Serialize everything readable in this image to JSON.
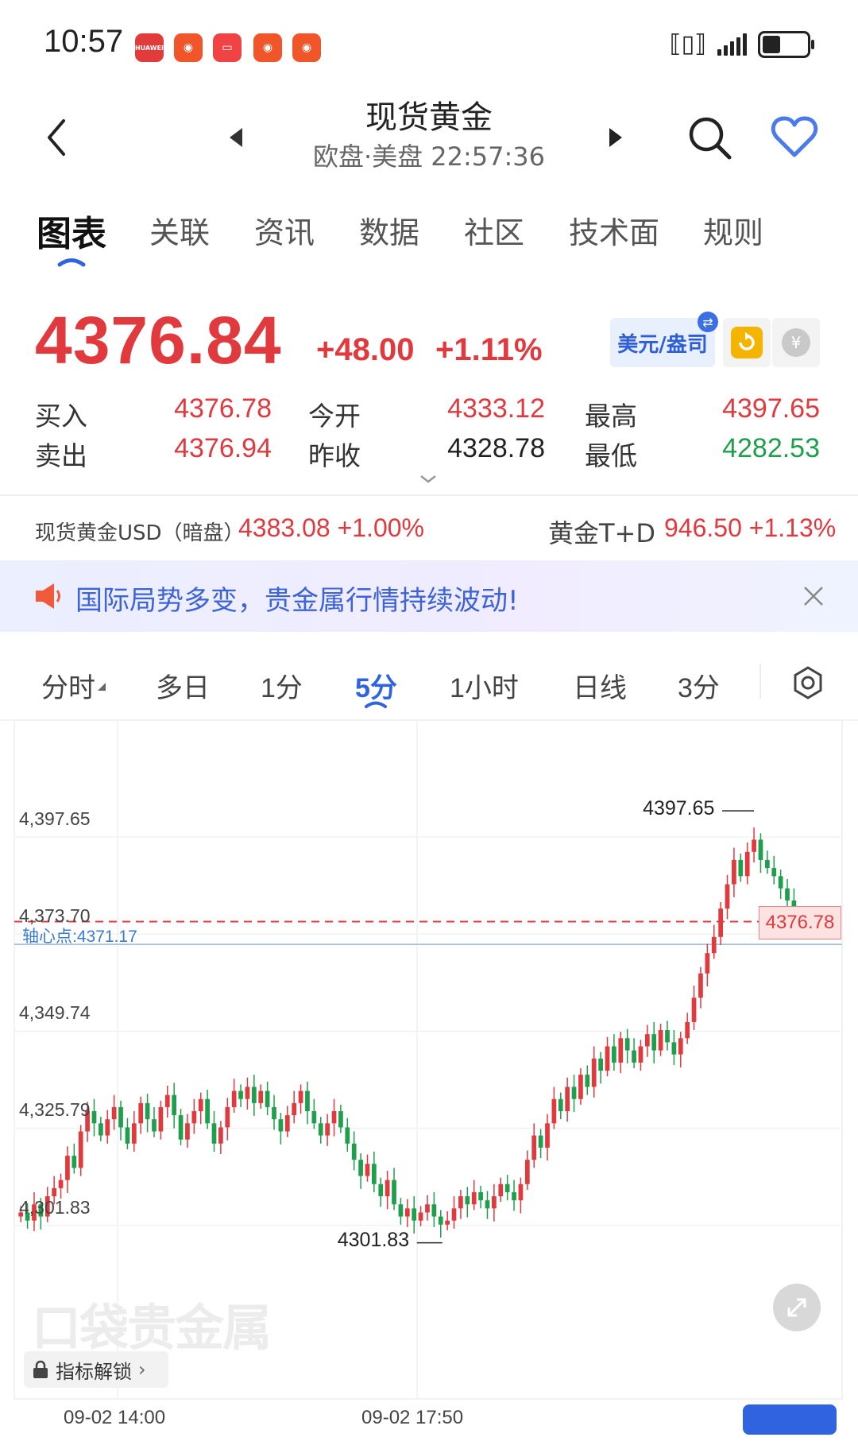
{
  "status_bar": {
    "time": "10:57",
    "apps": [
      "HUAWEI",
      "",
      "",
      "",
      ""
    ],
    "signal": "4G"
  },
  "header": {
    "title": "现货黄金",
    "subtitle": "欧盘·美盘  22:57:36"
  },
  "tabs": [
    "图表",
    "关联",
    "资讯",
    "数据",
    "社区",
    "技术面",
    "规则"
  ],
  "quote": {
    "price": "4376.84",
    "change": "+48.00",
    "change_pct": "+1.11%",
    "currency_btn": "美元/盎司",
    "rows": [
      {
        "l1": "买入",
        "v1": "4376.78",
        "l2": "今开",
        "v2": "4333.12",
        "l3": "最高",
        "v3": "4397.65"
      },
      {
        "l1": "卖出",
        "v1": "4376.94",
        "l2": "昨收",
        "v2": "4328.78",
        "l3": "最低",
        "v3": "4282.53"
      }
    ]
  },
  "related": {
    "left_label": "现货黄金USD（暗盘）",
    "left_value": "4383.08 +1.00%",
    "right_label": "黄金T+D",
    "right_value": "946.50 +1.13%"
  },
  "banner": {
    "text": "国际局势多变，贵金属行情持续波动!"
  },
  "periods": [
    "分时",
    "多日",
    "1分",
    "5分",
    "1小时",
    "日线",
    "3分"
  ],
  "chart": {
    "y_labels": [
      "4,397.65",
      "4,373.70",
      "4,349.74",
      "4,325.79",
      "4,301.83"
    ],
    "pivot_label": "轴心点:4371.17",
    "current_price_tag": "4376.78",
    "high_annot": "4397.65",
    "low_annot": "4301.83",
    "lock_label": "指标解锁",
    "x_labels": [
      "09-02 14:00",
      "09-02 17:50"
    ],
    "watermark": "口袋贵金属"
  },
  "chart_data": {
    "type": "candlestick",
    "ylim": [
      4282.53,
      4412
    ],
    "y_ticks": [
      4397.65,
      4373.7,
      4349.74,
      4325.79,
      4301.83
    ],
    "pivot": 4371.17,
    "last": 4376.78,
    "x_ticks": [
      "09-02 14:00",
      "09-02 17:50"
    ],
    "closes": [
      4305,
      4303,
      4307,
      4304,
      4309,
      4311,
      4313,
      4319,
      4316,
      4325,
      4330,
      4327,
      4324,
      4328,
      4331,
      4326,
      4322,
      4327,
      4332,
      4328,
      4325,
      4331,
      4334,
      4329,
      4323,
      4327,
      4330,
      4333,
      4327,
      4322,
      4326,
      4331,
      4335,
      4333,
      4336,
      4332,
      4335,
      4331,
      4328,
      4325,
      4329,
      4332,
      4335,
      4330,
      4327,
      4324,
      4327,
      4330,
      4326,
      4322,
      4318,
      4314,
      4317,
      4312,
      4309,
      4313,
      4307,
      4304,
      4306,
      4303,
      4305,
      4307,
      4304,
      4302,
      4303,
      4306,
      4309,
      4307,
      4310,
      4308,
      4306,
      4309,
      4312,
      4310,
      4308,
      4312,
      4318,
      4324,
      4321,
      4327,
      4333,
      4330,
      4336,
      4333,
      4339,
      4336,
      4343,
      4340,
      4346,
      4342,
      4348,
      4345,
      4342,
      4346,
      4349,
      4345,
      4350,
      4347,
      4344,
      4348,
      4352,
      4358,
      4364,
      4369,
      4373,
      4380,
      4386,
      4392,
      4388,
      4394,
      4397,
      4392,
      4390,
      4388,
      4385,
      4382,
      4379,
      4377
    ]
  }
}
